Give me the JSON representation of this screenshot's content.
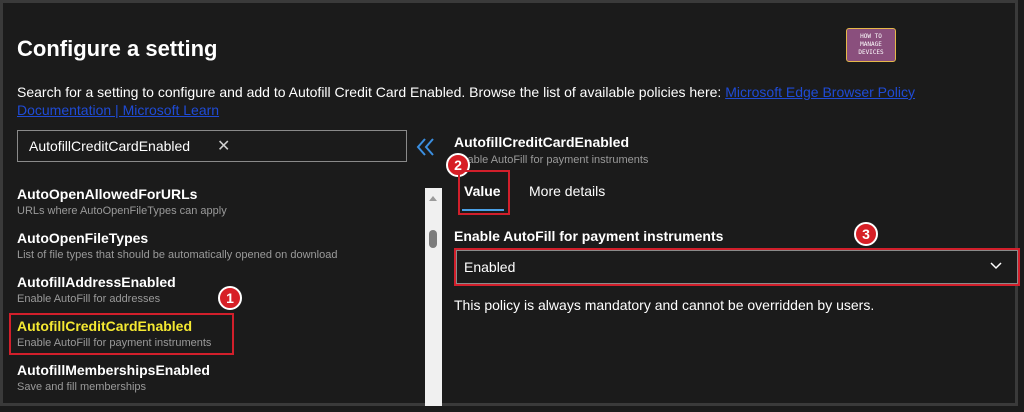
{
  "header": {
    "title": "Configure a setting",
    "logo_lines": [
      "HOW TO",
      "MANAGE",
      "DEVICES"
    ]
  },
  "description": {
    "text": "Search for a setting to configure and add to Autofill Credit Card Enabled. Browse the list of available policies here: ",
    "link_text": "Microsoft Edge Browser Policy Documentation | Microsoft Learn"
  },
  "search": {
    "value": "AutofillCreditCardEnabled",
    "clear_icon": "close-icon"
  },
  "collapse_icon": "double-chevron-left-icon",
  "settings_list": [
    {
      "name": "AutoOpenAllowedForURLs",
      "description": "URLs where AutoOpenFileTypes can apply"
    },
    {
      "name": "AutoOpenFileTypes",
      "description": "List of file types that should be automatically opened on download"
    },
    {
      "name": "AutofillAddressEnabled",
      "description": "Enable AutoFill for addresses"
    },
    {
      "name": "AutofillCreditCardEnabled",
      "description": "Enable AutoFill for payment instruments"
    },
    {
      "name": "AutofillMembershipsEnabled",
      "description": "Save and fill memberships"
    }
  ],
  "detail": {
    "title": "AutofillCreditCardEnabled",
    "subtitle": "Enable AutoFill for payment instruments",
    "tabs": [
      "Value",
      "More details"
    ],
    "field_label": "Enable AutoFill for payment instruments",
    "selected_value": "Enabled",
    "note": "This policy is always mandatory and cannot be overridden by users."
  },
  "annotations": [
    "1",
    "2",
    "3"
  ],
  "colors": {
    "background": "#1b1b1b",
    "highlight_text": "#f5e932",
    "annotation_red": "#d21f2b",
    "link": "#1f4bd6",
    "tab_underline": "#4aa0e6"
  }
}
